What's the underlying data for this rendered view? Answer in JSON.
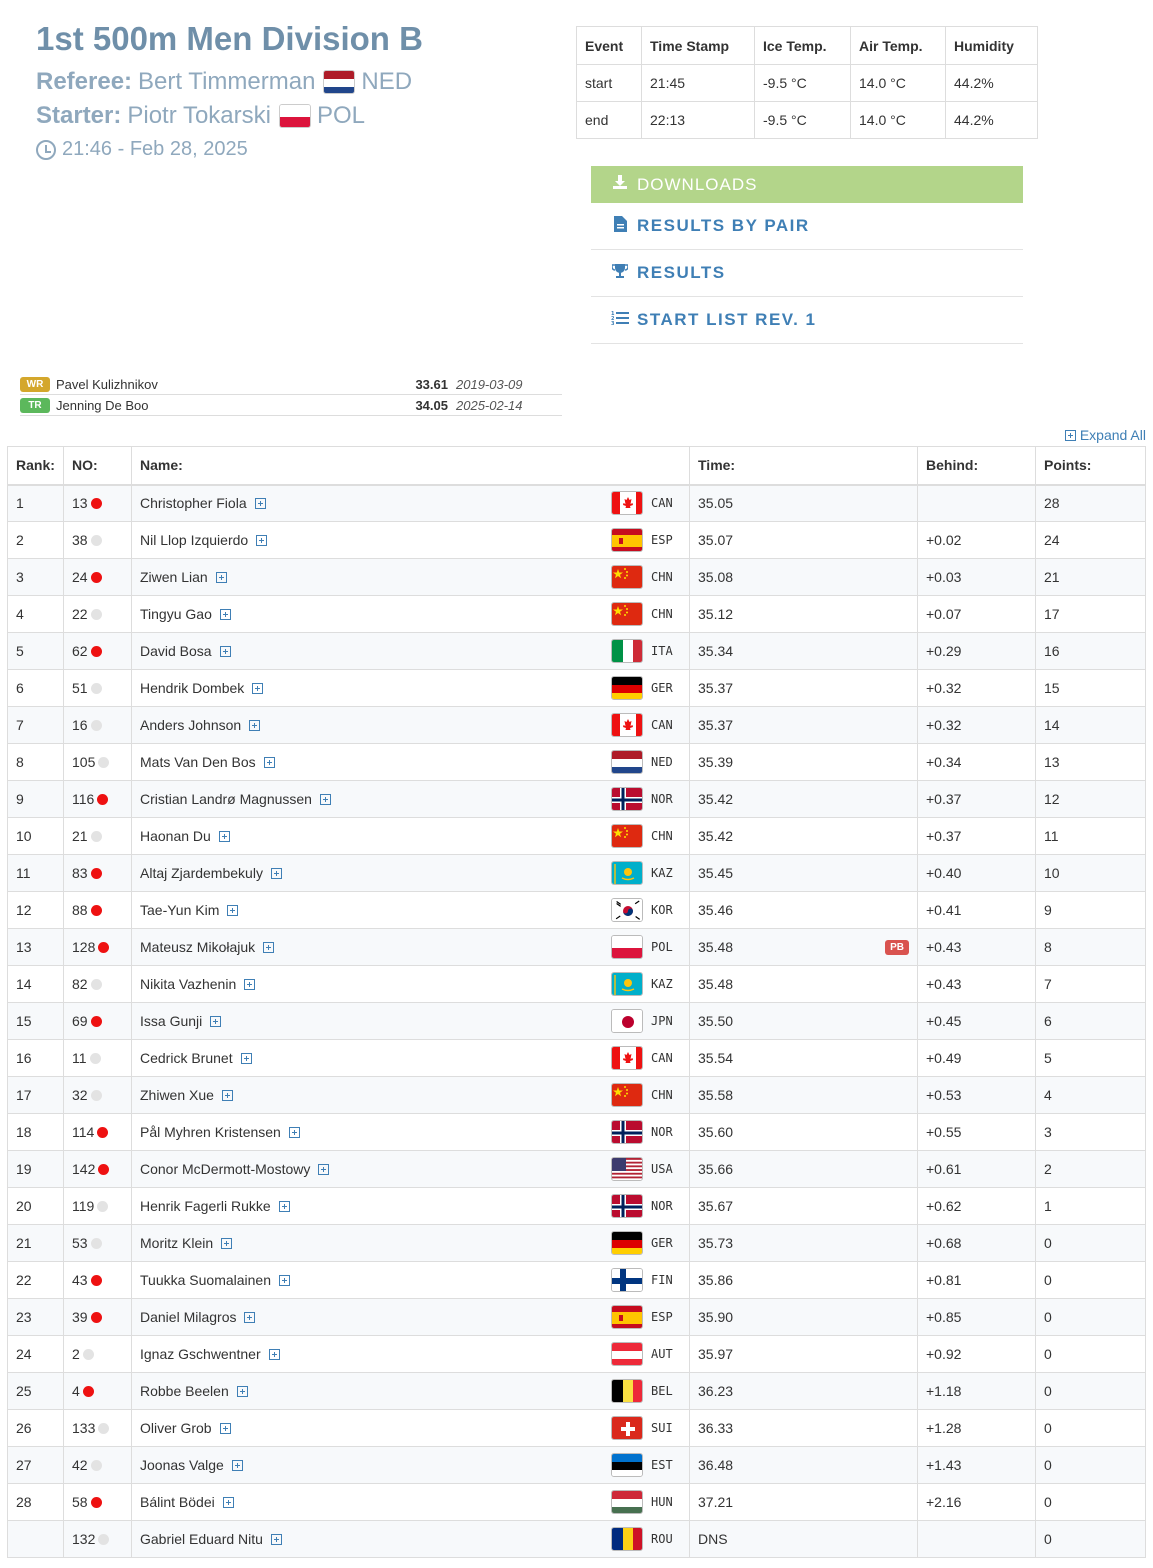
{
  "event": {
    "title": "1st 500m Men Division B",
    "referee_label": "Referee:",
    "referee_name": "Bert Timmerman",
    "referee_country": "NED",
    "starter_label": "Starter:",
    "starter_name": "Piotr Tokarski",
    "starter_country": "POL",
    "datetime": "21:46 - Feb 28, 2025"
  },
  "weather": {
    "headers": [
      "Event",
      "Time Stamp",
      "Ice Temp.",
      "Air Temp.",
      "Humidity"
    ],
    "rows": [
      [
        "start",
        "21:45",
        "-9.5 °C",
        "14.0 °C",
        "44.2%"
      ],
      [
        "end",
        "22:13",
        "-9.5 °C",
        "14.0 °C",
        "44.2%"
      ]
    ]
  },
  "downloads": {
    "header": "DOWNLOADS",
    "items": [
      {
        "label": "RESULTS BY PAIR",
        "icon": "document-icon"
      },
      {
        "label": "RESULTS",
        "icon": "trophy-icon"
      },
      {
        "label": "START LIST REV. 1",
        "icon": "ordered-list-icon"
      }
    ]
  },
  "records": [
    {
      "badge": "WR",
      "name": "Pavel Kulizhnikov",
      "time": "33.61",
      "date": "2019-03-09",
      "color": "#d4a72c"
    },
    {
      "badge": "TR",
      "name": "Jenning De Boo",
      "time": "34.05",
      "date": "2025-02-14",
      "color": "#5cb85c"
    }
  ],
  "expand_all": "Expand All",
  "results": {
    "headers": {
      "rank": "Rank:",
      "no": "NO:",
      "name": "Name:",
      "time": "Time:",
      "behind": "Behind:",
      "points": "Points:"
    },
    "rows": [
      {
        "rank": "1",
        "no": "13",
        "dot": "red",
        "name": "Christopher Fiola",
        "country": "CAN",
        "time": "35.05",
        "pb": "",
        "behind": "",
        "points": "28"
      },
      {
        "rank": "2",
        "no": "38",
        "dot": "grey",
        "name": "Nil Llop Izquierdo",
        "country": "ESP",
        "time": "35.07",
        "pb": "",
        "behind": "+0.02",
        "points": "24"
      },
      {
        "rank": "3",
        "no": "24",
        "dot": "red",
        "name": "Ziwen Lian",
        "country": "CHN",
        "time": "35.08",
        "pb": "",
        "behind": "+0.03",
        "points": "21"
      },
      {
        "rank": "4",
        "no": "22",
        "dot": "grey",
        "name": "Tingyu Gao",
        "country": "CHN",
        "time": "35.12",
        "pb": "",
        "behind": "+0.07",
        "points": "17"
      },
      {
        "rank": "5",
        "no": "62",
        "dot": "red",
        "name": "David Bosa",
        "country": "ITA",
        "time": "35.34",
        "pb": "",
        "behind": "+0.29",
        "points": "16"
      },
      {
        "rank": "6",
        "no": "51",
        "dot": "grey",
        "name": "Hendrik Dombek",
        "country": "GER",
        "time": "35.37",
        "pb": "",
        "behind": "+0.32",
        "points": "15"
      },
      {
        "rank": "7",
        "no": "16",
        "dot": "grey",
        "name": "Anders Johnson",
        "country": "CAN",
        "time": "35.37",
        "pb": "",
        "behind": "+0.32",
        "points": "14"
      },
      {
        "rank": "8",
        "no": "105",
        "dot": "grey",
        "name": "Mats Van Den Bos",
        "country": "NED",
        "time": "35.39",
        "pb": "",
        "behind": "+0.34",
        "points": "13"
      },
      {
        "rank": "9",
        "no": "116",
        "dot": "red",
        "name": "Cristian Landrø Magnussen",
        "country": "NOR",
        "time": "35.42",
        "pb": "",
        "behind": "+0.37",
        "points": "12"
      },
      {
        "rank": "10",
        "no": "21",
        "dot": "grey",
        "name": "Haonan Du",
        "country": "CHN",
        "time": "35.42",
        "pb": "",
        "behind": "+0.37",
        "points": "11"
      },
      {
        "rank": "11",
        "no": "83",
        "dot": "red",
        "name": "Altaj Zjardembekuly",
        "country": "KAZ",
        "time": "35.45",
        "pb": "",
        "behind": "+0.40",
        "points": "10"
      },
      {
        "rank": "12",
        "no": "88",
        "dot": "red",
        "name": "Tae-Yun Kim",
        "country": "KOR",
        "time": "35.46",
        "pb": "",
        "behind": "+0.41",
        "points": "9"
      },
      {
        "rank": "13",
        "no": "128",
        "dot": "red",
        "name": "Mateusz Mikołajuk",
        "country": "POL",
        "time": "35.48",
        "pb": "PB",
        "behind": "+0.43",
        "points": "8"
      },
      {
        "rank": "14",
        "no": "82",
        "dot": "grey",
        "name": "Nikita Vazhenin",
        "country": "KAZ",
        "time": "35.48",
        "pb": "",
        "behind": "+0.43",
        "points": "7"
      },
      {
        "rank": "15",
        "no": "69",
        "dot": "red",
        "name": "Issa Gunji",
        "country": "JPN",
        "time": "35.50",
        "pb": "",
        "behind": "+0.45",
        "points": "6"
      },
      {
        "rank": "16",
        "no": "11",
        "dot": "grey",
        "name": "Cedrick Brunet",
        "country": "CAN",
        "time": "35.54",
        "pb": "",
        "behind": "+0.49",
        "points": "5"
      },
      {
        "rank": "17",
        "no": "32",
        "dot": "grey",
        "name": "Zhiwen Xue",
        "country": "CHN",
        "time": "35.58",
        "pb": "",
        "behind": "+0.53",
        "points": "4"
      },
      {
        "rank": "18",
        "no": "114",
        "dot": "red",
        "name": "Pål Myhren Kristensen",
        "country": "NOR",
        "time": "35.60",
        "pb": "",
        "behind": "+0.55",
        "points": "3"
      },
      {
        "rank": "19",
        "no": "142",
        "dot": "red",
        "name": "Conor McDermott-Mostowy",
        "country": "USA",
        "time": "35.66",
        "pb": "",
        "behind": "+0.61",
        "points": "2"
      },
      {
        "rank": "20",
        "no": "119",
        "dot": "grey",
        "name": "Henrik Fagerli Rukke",
        "country": "NOR",
        "time": "35.67",
        "pb": "",
        "behind": "+0.62",
        "points": "1"
      },
      {
        "rank": "21",
        "no": "53",
        "dot": "grey",
        "name": "Moritz Klein",
        "country": "GER",
        "time": "35.73",
        "pb": "",
        "behind": "+0.68",
        "points": "0"
      },
      {
        "rank": "22",
        "no": "43",
        "dot": "red",
        "name": "Tuukka Suomalainen",
        "country": "FIN",
        "time": "35.86",
        "pb": "",
        "behind": "+0.81",
        "points": "0"
      },
      {
        "rank": "23",
        "no": "39",
        "dot": "red",
        "name": "Daniel Milagros",
        "country": "ESP",
        "time": "35.90",
        "pb": "",
        "behind": "+0.85",
        "points": "0"
      },
      {
        "rank": "24",
        "no": "2",
        "dot": "grey",
        "name": "Ignaz Gschwentner",
        "country": "AUT",
        "time": "35.97",
        "pb": "",
        "behind": "+0.92",
        "points": "0"
      },
      {
        "rank": "25",
        "no": "4",
        "dot": "red",
        "name": "Robbe Beelen",
        "country": "BEL",
        "time": "36.23",
        "pb": "",
        "behind": "+1.18",
        "points": "0"
      },
      {
        "rank": "26",
        "no": "133",
        "dot": "grey",
        "name": "Oliver Grob",
        "country": "SUI",
        "time": "36.33",
        "pb": "",
        "behind": "+1.28",
        "points": "0"
      },
      {
        "rank": "27",
        "no": "42",
        "dot": "grey",
        "name": "Joonas Valge",
        "country": "EST",
        "time": "36.48",
        "pb": "",
        "behind": "+1.43",
        "points": "0"
      },
      {
        "rank": "28",
        "no": "58",
        "dot": "red",
        "name": "Bálint Bödei",
        "country": "HUN",
        "time": "37.21",
        "pb": "",
        "behind": "+2.16",
        "points": "0"
      },
      {
        "rank": "",
        "no": "132",
        "dot": "grey",
        "name": "Gabriel Eduard Nitu",
        "country": "ROU",
        "time": "DNS",
        "pb": "",
        "behind": "",
        "points": "0"
      }
    ]
  }
}
